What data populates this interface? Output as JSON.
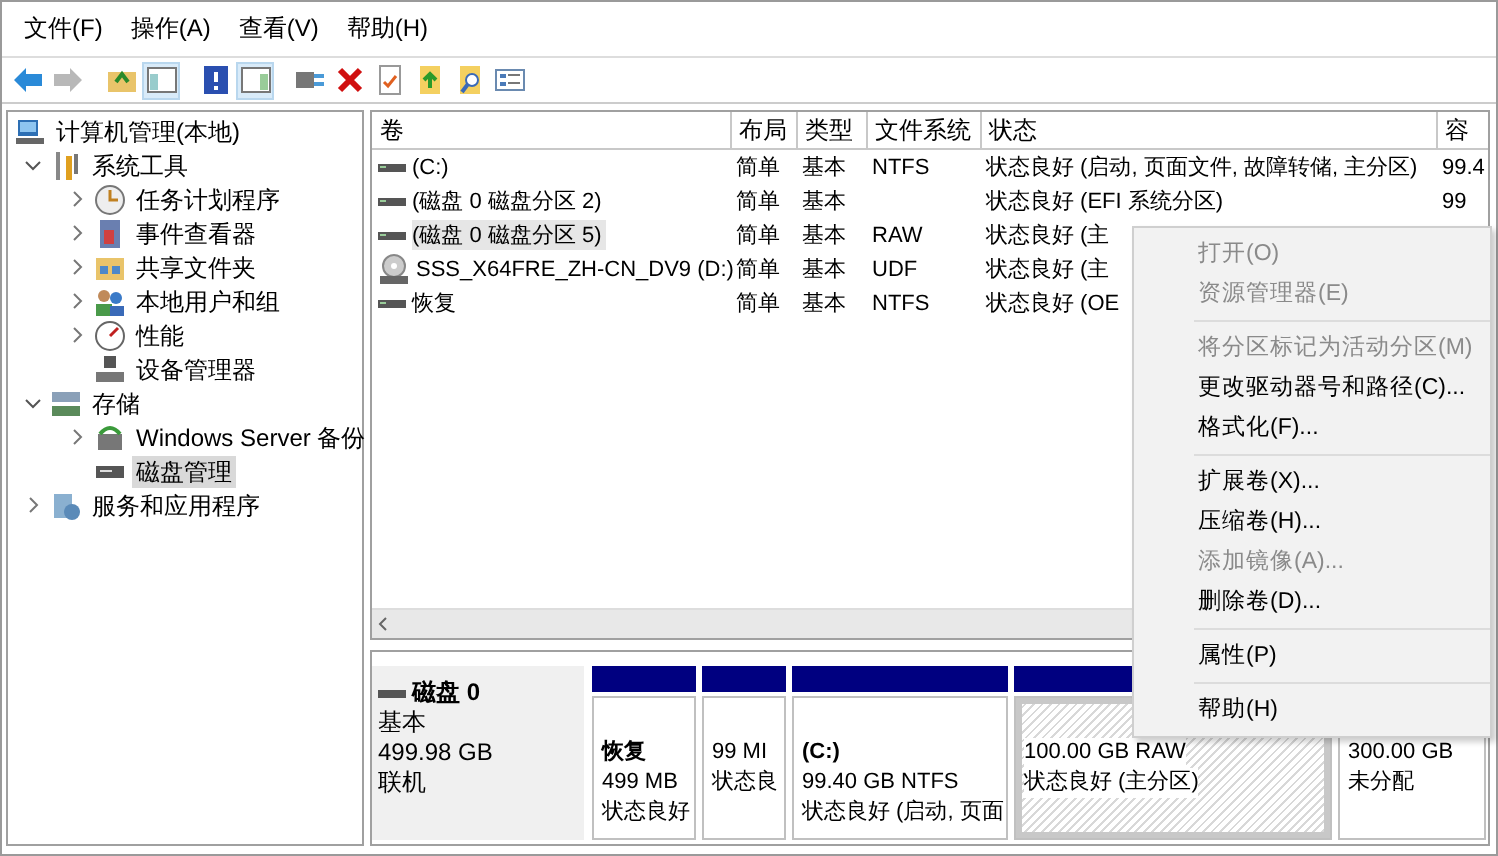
{
  "menu": [
    "文件(F)",
    "操作(A)",
    "查看(V)",
    "帮助(H)"
  ],
  "toolbar": [
    {
      "pressed": false,
      "disabled": false
    },
    {
      "pressed": false,
      "disabled": true
    },
    {
      "pressed": false,
      "disabled": false
    },
    {
      "pressed": true,
      "disabled": false
    },
    {
      "pressed": false,
      "disabled": false
    },
    {
      "pressed": true,
      "disabled": false
    },
    {
      "pressed": false,
      "disabled": false
    },
    {
      "pressed": false,
      "disabled": false
    },
    {
      "pressed": false,
      "disabled": false
    },
    {
      "pressed": false,
      "disabled": false
    },
    {
      "pressed": false,
      "disabled": false
    },
    {
      "pressed": false,
      "disabled": false
    }
  ],
  "tree": [
    {
      "label": "计算机管理(本地)",
      "selected": false,
      "children": [
        {
          "label": "系统工具",
          "expanded": true,
          "selected": false,
          "children": [
            {
              "label": "任务计划程序",
              "expanded": false,
              "selected": false
            },
            {
              "label": "事件查看器",
              "expanded": false,
              "selected": false
            },
            {
              "label": "共享文件夹",
              "expanded": false,
              "selected": false
            },
            {
              "label": "本地用户和组",
              "expanded": false,
              "selected": false
            },
            {
              "label": "性能",
              "expanded": false,
              "selected": false
            },
            {
              "label": "设备管理器",
              "selected": false
            }
          ]
        },
        {
          "label": "存储",
          "expanded": true,
          "selected": false,
          "children": [
            {
              "label": "Windows Server 备份",
              "expanded": false,
              "selected": false
            },
            {
              "label": "磁盘管理",
              "selected": true
            }
          ]
        },
        {
          "label": "服务和应用程序",
          "expanded": false,
          "selected": false
        }
      ]
    }
  ],
  "volume_table": {
    "columns": [
      "卷",
      "布局",
      "类型",
      "文件系统",
      "状态",
      "容"
    ],
    "rows": [
      {
        "kind": "disk",
        "selected": false,
        "cells": [
          "(C:)",
          "简单",
          "基本",
          "NTFS",
          "状态良好 (启动, 页面文件, 故障转储, 主分区)",
          "99.4"
        ]
      },
      {
        "kind": "disk",
        "selected": false,
        "cells": [
          "(磁盘 0 磁盘分区 2)",
          "简单",
          "基本",
          "",
          "状态良好 (EFI 系统分区)",
          "99"
        ]
      },
      {
        "kind": "disk",
        "selected": true,
        "cells": [
          "(磁盘 0 磁盘分区 5)",
          "简单",
          "基本",
          "RAW",
          "状态良好 (主",
          ""
        ]
      },
      {
        "kind": "optical",
        "selected": false,
        "cells": [
          "SSS_X64FRE_ZH-CN_DV9 (D:)",
          "简单",
          "基本",
          "UDF",
          "状态良好 (主",
          ""
        ]
      },
      {
        "kind": "disk",
        "selected": false,
        "cells": [
          "恢复",
          "简单",
          "基本",
          "NTFS",
          "状态良好 (OE",
          ""
        ]
      }
    ]
  },
  "disk": {
    "name": "磁盘 0",
    "type": "基本",
    "size": "499.98 GB",
    "status": "联机",
    "partitions": [
      {
        "title": "恢复",
        "size": "499 MB",
        "status": "状态良好",
        "selected": false
      },
      {
        "size": "99 MI",
        "status": "状态良",
        "selected": false
      },
      {
        "title": "(C:)",
        "size": "99.40 GB NTFS",
        "status": "状态良好 (启动, 页面",
        "selected": false
      },
      {
        "size": "100.00 GB RAW",
        "status": "状态良好 (主分区)",
        "selected": true
      },
      {
        "size": "300.00 GB",
        "status": "未分配",
        "selected": false
      }
    ]
  },
  "context_menu": [
    {
      "label": "打开(O)",
      "disabled": true,
      "separator_after": false
    },
    {
      "label": "资源管理器(E)",
      "disabled": true,
      "separator_after": true
    },
    {
      "label": "将分区标记为活动分区(M)",
      "disabled": true,
      "separator_after": false
    },
    {
      "label": "更改驱动器号和路径(C)...",
      "disabled": false,
      "separator_after": false
    },
    {
      "label": "格式化(F)...",
      "disabled": false,
      "separator_after": true
    },
    {
      "label": "扩展卷(X)...",
      "disabled": false,
      "separator_after": false
    },
    {
      "label": "压缩卷(H)...",
      "disabled": false,
      "separator_after": false
    },
    {
      "label": "添加镜像(A)...",
      "disabled": true,
      "separator_after": false
    },
    {
      "label": "删除卷(D)...",
      "disabled": false,
      "separator_after": true
    },
    {
      "label": "属性(P)",
      "disabled": false,
      "separator_after": true
    },
    {
      "label": "帮助(H)",
      "disabled": false,
      "separator_after": false
    }
  ]
}
